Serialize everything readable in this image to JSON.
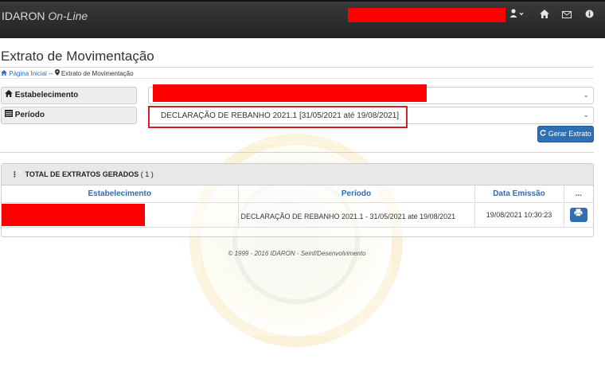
{
  "app": {
    "brand": "IDARON",
    "brand_suffix": "On-Line"
  },
  "navbar": {
    "user_icon": "user-icon",
    "icons": [
      "home-icon",
      "mail-icon",
      "info-icon"
    ]
  },
  "page": {
    "title": "Extrato de Movimentação",
    "breadcrumb": {
      "home_label": "Página Inicial",
      "separator": "--",
      "current_label": "Extrato de Movimentação"
    }
  },
  "form": {
    "estabelecimento_label": "Estabelecimento",
    "periodo_label": "Período",
    "periodo_value": "DECLARAÇÃO DE REBANHO 2021.1 [31/05/2021 até 19/08/2021]",
    "gerar_button": "Gerar Extrato"
  },
  "results": {
    "heading": "TOTAL DE EXTRATOS GERADOS",
    "count": "( 1 )",
    "columns": [
      "Estabelecimento",
      "Período",
      "Data Emissão",
      "..."
    ],
    "rows": [
      {
        "periodo": "DECLARAÇÃO DE REBANHO 2021.1 - 31/05/2021 até 19/08/2021",
        "data_emissao": "19/08/2021 10:30:23"
      }
    ]
  },
  "footer": {
    "text": "© 1999 - 2016 IDARON - Seinf/Desenvolvimento"
  },
  "colors": {
    "navbar": "#2b2b2b",
    "accent": "#2f6fb3",
    "highlight": "#d32020",
    "redaction": "#ff0000"
  }
}
